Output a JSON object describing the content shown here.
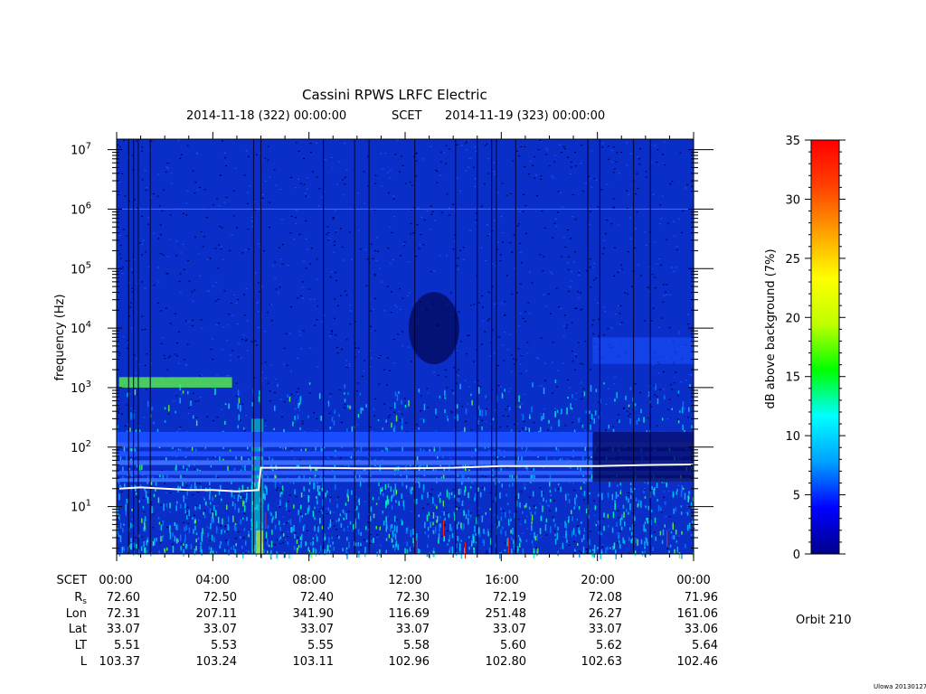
{
  "chart_data": {
    "type": "heatmap",
    "title": "Cassini RPWS LRFC Electric",
    "subtitle": {
      "start": "2014-11-18 (322) 00:00:00",
      "mid": "SCET",
      "end": "2014-11-19 (323) 00:00:00"
    },
    "ylabel": "frequency (Hz)",
    "yscale": "log",
    "ylim": [
      1.6,
      15000000
    ],
    "yticks": [
      {
        "base": "10",
        "exp": "1",
        "value": 10
      },
      {
        "base": "10",
        "exp": "2",
        "value": 100
      },
      {
        "base": "10",
        "exp": "3",
        "value": 1000
      },
      {
        "base": "10",
        "exp": "4",
        "value": 10000
      },
      {
        "base": "10",
        "exp": "5",
        "value": 100000
      },
      {
        "base": "10",
        "exp": "6",
        "value": 1000000
      },
      {
        "base": "10",
        "exp": "7",
        "value": 10000000
      }
    ],
    "x_hours": [
      0,
      4,
      8,
      12,
      16,
      20,
      24
    ],
    "xlim_hours": [
      0,
      24
    ],
    "colorbar": {
      "label": "dB above background (7%)",
      "range": [
        0,
        35
      ],
      "ticks": [
        "0",
        "5",
        "10",
        "15",
        "20",
        "25",
        "30",
        "35"
      ],
      "colors": [
        "#00008a",
        "#0000ff",
        "#00a0ff",
        "#00ffff",
        "#00ff00",
        "#c0ff00",
        "#ffff00",
        "#ffa000",
        "#ff4000",
        "#ff0000"
      ]
    },
    "white_trace": [
      {
        "hour": 0.1,
        "hz": 20
      },
      {
        "hour": 1.0,
        "hz": 21
      },
      {
        "hour": 2.0,
        "hz": 20
      },
      {
        "hour": 3.0,
        "hz": 19
      },
      {
        "hour": 4.0,
        "hz": 19
      },
      {
        "hour": 5.0,
        "hz": 18
      },
      {
        "hour": 5.9,
        "hz": 19
      },
      {
        "hour": 6.0,
        "hz": 45
      },
      {
        "hour": 8.0,
        "hz": 45
      },
      {
        "hour": 10.0,
        "hz": 44
      },
      {
        "hour": 12.0,
        "hz": 44
      },
      {
        "hour": 14.0,
        "hz": 45
      },
      {
        "hour": 16.0,
        "hz": 48
      },
      {
        "hour": 18.0,
        "hz": 48
      },
      {
        "hour": 20.0,
        "hz": 48
      },
      {
        "hour": 22.0,
        "hz": 50
      },
      {
        "hour": 24.0,
        "hz": 51
      }
    ]
  },
  "ephemeris": {
    "rows": [
      {
        "label": "SCET",
        "values": [
          "00:00",
          "04:00",
          "08:00",
          "12:00",
          "16:00",
          "20:00",
          "00:00"
        ]
      },
      {
        "label": "R",
        "sub": "s",
        "values": [
          "72.60",
          "72.50",
          "72.40",
          "72.30",
          "72.19",
          "72.08",
          "71.96"
        ]
      },
      {
        "label": "Lon",
        "values": [
          "72.31",
          "207.11",
          "341.90",
          "116.69",
          "251.48",
          "26.27",
          "161.06"
        ]
      },
      {
        "label": "Lat",
        "values": [
          "33.07",
          "33.07",
          "33.07",
          "33.07",
          "33.07",
          "33.07",
          "33.06"
        ]
      },
      {
        "label": "LT",
        "values": [
          "5.51",
          "5.53",
          "5.55",
          "5.58",
          "5.60",
          "5.62",
          "5.64"
        ]
      },
      {
        "label": "L",
        "values": [
          "103.37",
          "103.24",
          "103.11",
          "102.96",
          "102.80",
          "102.63",
          "102.46"
        ]
      }
    ]
  },
  "orbit": "Orbit 210",
  "credit": "Ulowa 20130127"
}
